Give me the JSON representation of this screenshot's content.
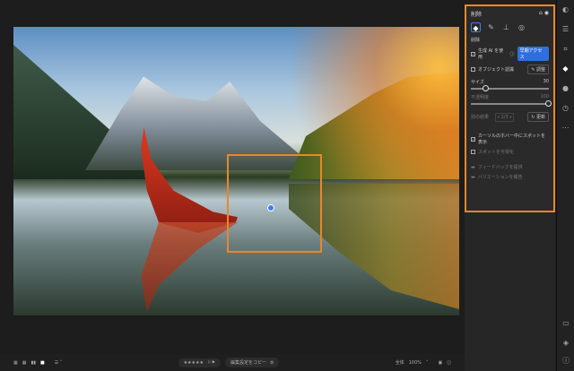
{
  "panel": {
    "title": "削除",
    "section": "削除",
    "use_gen_ai": "生成 AI を使用",
    "early_access": "早期アクセス",
    "object_detect": "オブジェクト認識",
    "adjust": "調整",
    "size_label": "サイズ",
    "size_value": "30",
    "size_fraction": 0.2,
    "opacity_label": "不透明度",
    "opacity_value": "100",
    "opacity_fraction": 1.0,
    "other_results": "別の結果",
    "pager": "1/3",
    "refresh": "更新",
    "show_spot_on_hover": "カーソルのホバー中にスポットを表示",
    "show_spot_checked": true,
    "visualize_spots": "スポットを可視化",
    "visualize_checked": false,
    "feedback": "フィードバックを提供",
    "report": "バリエーションを報告"
  },
  "bottom": {
    "stars": "★★★★★",
    "copy_settings": "編集設定をコピー",
    "fit": "全体",
    "zoom": "100%"
  }
}
